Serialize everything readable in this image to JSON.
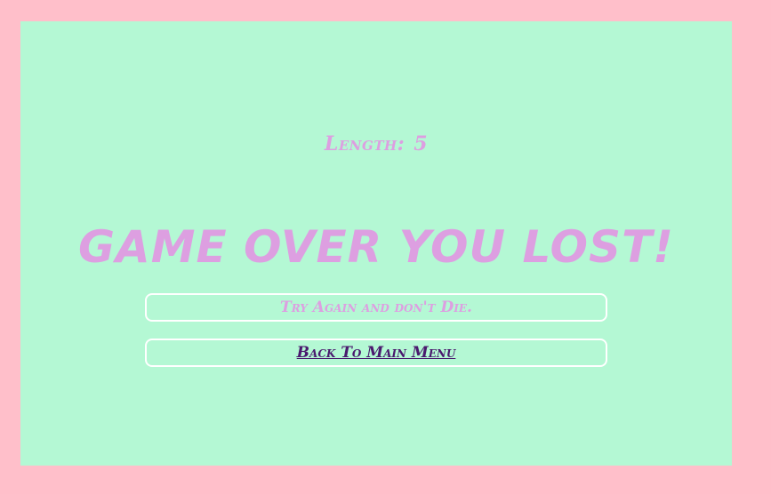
{
  "game": {
    "length_label": "Length:",
    "length_value": "5",
    "title": "GAME OVER YOU LOST!",
    "try_again_label": "Try Again and don't Die.",
    "main_menu_label": "Back To Main Menu"
  },
  "colors": {
    "page_background": "#ffbfca",
    "game_background": "#b4f8d4",
    "text_pink": "#dd9fe1",
    "link_purple": "#4a1a6e",
    "button_border": "#ffffff"
  }
}
